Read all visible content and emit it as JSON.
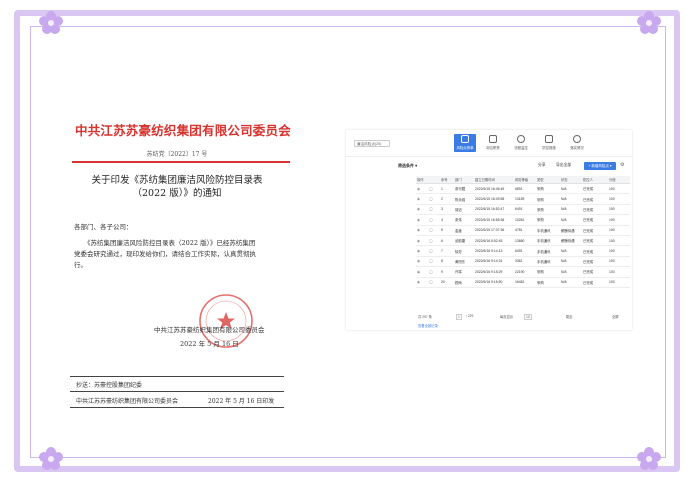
{
  "document": {
    "header": "中共江苏苏豪纺织集团有限公司委员会",
    "doc_number": "苏纺党〔2022〕17 号",
    "title_line1": "关于印发《苏纺集团廉洁风险防控目录表",
    "title_line2": "（2022 版）》的通知",
    "salutation": "各部门、各子公司：",
    "body_line1": "《苏纺集团廉洁风险防控目录表（2022 版）》已经苏纺集团",
    "body_line2": "党委会研究通过，现印发给你们，请结合工作实际，认真贯彻执",
    "body_line3": "行。",
    "signature": "中共江苏苏豪纺织集团有限公司委员会",
    "sign_date": "2022 年 5 月 16 日",
    "cc": "抄送：苏豪控股集团纪委",
    "footer_org": "中共江苏苏豪纺织集团有限公司委员会",
    "footer_date": "2022 年 5 月 16 日印发",
    "seal_color": "#d7332f"
  },
  "app": {
    "select_label": "廉洁风险点(20)",
    "nav": [
      {
        "label": "风险点清单",
        "icon": "list-icon",
        "active": true
      },
      {
        "label": "岗位职责",
        "icon": "person-icon",
        "active": false
      },
      {
        "label": "流程监控",
        "icon": "clock-icon",
        "active": false
      },
      {
        "label": "防控措施",
        "icon": "shield-icon",
        "active": false
      },
      {
        "label": "落实情况",
        "icon": "check-icon",
        "active": false
      }
    ],
    "toolbar": {
      "filter": "筛选条件 ▾",
      "share": "分享",
      "export": "导出全部",
      "button": "+ 新增风险点 ▾",
      "gear": "⚙"
    },
    "columns": [
      "操作",
      "",
      "序号",
      "部门",
      "建立日期时间",
      "风险等级",
      "类型",
      "状态",
      "防控人",
      "分值"
    ],
    "rows": [
      [
        "",
        "",
        "1",
        "张可藏",
        "2022/6/15 16:46:45",
        "6891",
        "采购",
        "N/A",
        "已完成",
        "100"
      ],
      [
        "",
        "",
        "2",
        "陈永强",
        "2022/6/15 16:49:58",
        "13189",
        "采购",
        "N/A",
        "已完成",
        "100"
      ],
      [
        "",
        "",
        "3",
        "胡迈",
        "2022/6/15 16:52:47",
        "6491",
        "采购",
        "N/A",
        "已完成",
        "100"
      ],
      [
        "",
        "",
        "4",
        "张伟",
        "2022/6/15 16:55:36",
        "10281",
        "采购",
        "N/A",
        "已完成",
        "100"
      ],
      [
        "",
        "",
        "5",
        "金鑫",
        "2022/6/15 17:07:36",
        "4781",
        "手机通讯",
        "薪酬待遇",
        "已完成",
        "100"
      ],
      [
        "",
        "",
        "6",
        "武韵婕",
        "2022/6/16 8:52:45",
        "13680",
        "手机通讯",
        "薪酬待遇",
        "已完成",
        "100"
      ],
      [
        "",
        "",
        "7",
        "徐芳",
        "2022/6/16 9:14:13",
        "6491",
        "手机通讯",
        "N/A",
        "已完成",
        "100"
      ],
      [
        "",
        "",
        "8",
        "黄阳东",
        "2022/6/16 9:14:31",
        "3361",
        "手机通讯",
        "N/A",
        "已完成",
        "100"
      ],
      [
        "",
        "",
        "9",
        "许寒",
        "2022/6/16 9:15:29",
        "22190",
        "采购",
        "N/A",
        "已完成",
        "100"
      ],
      [
        "",
        "",
        "20",
        "顾雨",
        "2022/6/16 9:15:50",
        "16481",
        "采购",
        "N/A",
        "已完成",
        "100"
      ]
    ],
    "pager": {
      "total": "共 297 条",
      "page": "1",
      "of": "/ 229",
      "per_page": "每页显示",
      "per_count": "10",
      "jump": "跳至",
      "fullscreen": "全屏"
    },
    "link": "查看全部记录"
  },
  "colors": {
    "frame": "#d9c6f2",
    "flower": "#c8a8ee",
    "accent": "#3b7be6",
    "red": "#d7332f"
  }
}
